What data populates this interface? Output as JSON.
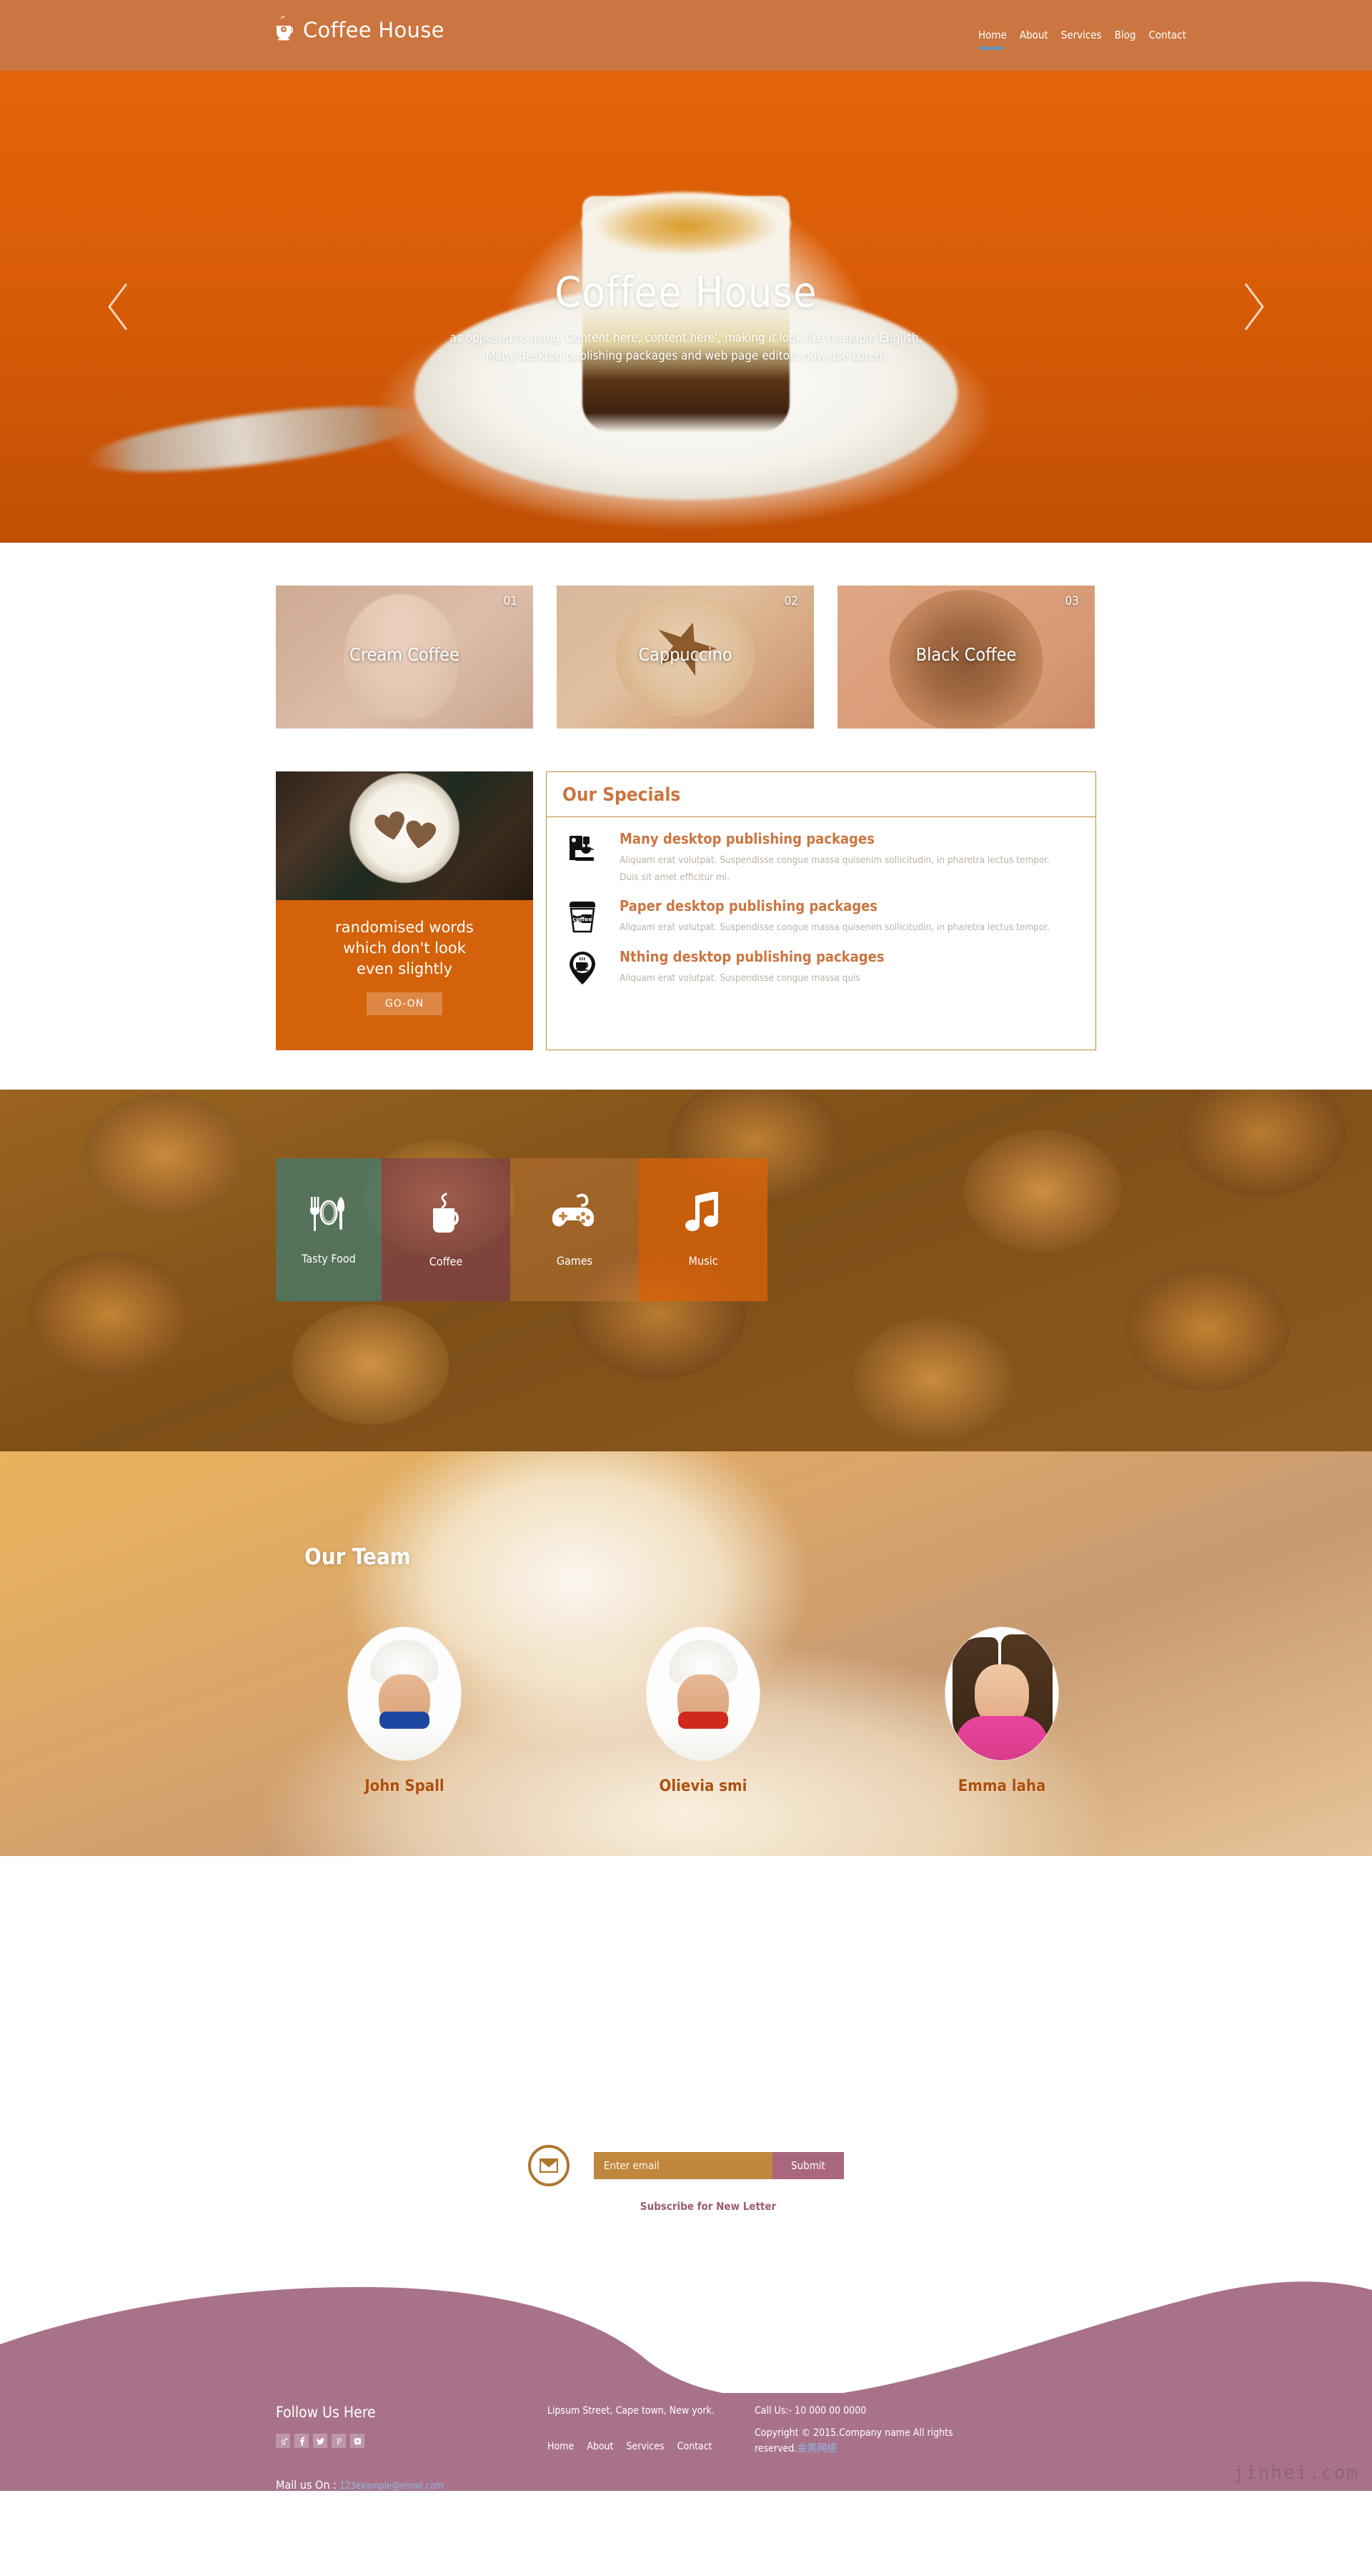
{
  "brand": {
    "name": "Coffee House",
    "logo_icon": "coffee-cup-icon"
  },
  "nav": {
    "items": [
      {
        "label": "Home",
        "active": true
      },
      {
        "label": "About",
        "active": false
      },
      {
        "label": "Services",
        "active": false
      },
      {
        "label": "Blog",
        "active": false
      },
      {
        "label": "Contact",
        "active": false
      }
    ]
  },
  "hero": {
    "title": "Coffee House",
    "line1": "as opposed to using 'Content here, content here', making it look like readable English.",
    "line2": "Many desktop publishing packages and web page editors now use Lorem",
    "prev_icon": "chevron-left-icon",
    "next_icon": "chevron-right-icon"
  },
  "cards": [
    {
      "num": "01",
      "label": "Cream Coffee"
    },
    {
      "num": "02",
      "label": "Cappuccino"
    },
    {
      "num": "03",
      "label": "Black Coffee"
    }
  ],
  "promo": {
    "text_line1": "randomised words",
    "text_line2": "which don't look",
    "text_line3": "even slightly",
    "button": "GO-ON"
  },
  "specials": {
    "heading": "Our Specials",
    "items": [
      {
        "icon": "coffee-machine-icon",
        "title": "Many desktop publishing packages",
        "desc": "Aliquam erat volutpat. Suspendisse congue massa quisenim sollicitudin, in pharetra lectus tempor. Duis sit amet efficitur mi."
      },
      {
        "icon": "coffee-togo-cup-icon",
        "title": "Paper desktop publishing packages",
        "desc": "Aliquam erat volutpat. Suspendisse congue massa quisenim sollicitudin, in pharetra lectus tempor."
      },
      {
        "icon": "coffee-location-pin-icon",
        "title": "Nthing desktop publishing packages",
        "desc": "Aliquam erat volutpat. Suspendisse congue massa quis"
      }
    ]
  },
  "services": {
    "tiles": [
      {
        "label": "Tasty Food",
        "icon": "fork-plate-knife-icon",
        "color": "#427d73"
      },
      {
        "label": "Coffee",
        "icon": "coffee-mug-steam-icon",
        "color": "#7c3c50"
      },
      {
        "label": "Games",
        "icon": "gamepad-icon",
        "color": "#c57b3a"
      },
      {
        "label": "Music",
        "icon": "music-note-icon",
        "color": "#d8620a"
      }
    ]
  },
  "team": {
    "heading": "Our Team",
    "members": [
      {
        "name": "John Spall",
        "avatar": "chef-male-avatar"
      },
      {
        "name": "Olievia smi",
        "avatar": "chef-female-avatar"
      },
      {
        "name": "Emma laha",
        "avatar": "woman-avatar"
      }
    ]
  },
  "newsletter": {
    "mail_icon": "envelope-icon",
    "placeholder": "Enter email",
    "value": "",
    "submit_label": "Submit",
    "caption": "Subscribe for New Letter"
  },
  "footer": {
    "follow_title": "Follow Us Here",
    "socials": [
      {
        "name": "google-plus-icon",
        "glyph": "g+"
      },
      {
        "name": "facebook-icon",
        "glyph": "f"
      },
      {
        "name": "twitter-icon",
        "glyph": "t"
      },
      {
        "name": "pinterest-icon",
        "glyph": "P"
      },
      {
        "name": "youtube-icon",
        "glyph": "yt"
      }
    ],
    "mail_label": "Mail us On : ",
    "mail_address": "123example@email.com",
    "address": "Lipsum Street, Cape town, New york.",
    "links": [
      "Home",
      "About",
      "Services",
      "Contact"
    ],
    "call": "Call Us:- 10 000 00 0000",
    "copyright": "Copyright © 2015.Company name All rights reserved.",
    "copyright_link": "金黑网络",
    "watermark": "jinhei.com"
  },
  "colors": {
    "header": "#cb7540",
    "accent_orange": "#d4620a",
    "specials_border": "#c08a3a",
    "footer": "#a8738a",
    "nav_underline": "#6e94b5",
    "team_name": "#b04f0c"
  }
}
